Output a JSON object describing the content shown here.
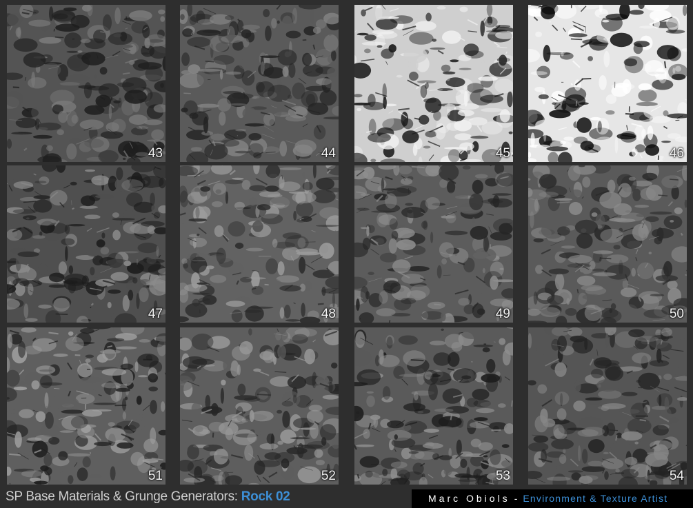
{
  "tiles": [
    {
      "label": "43",
      "tone": "#545454",
      "spot": "#7a7a7a",
      "dark": "#1e1e1e"
    },
    {
      "label": "44",
      "tone": "#5a5a5a",
      "spot": "#858585",
      "dark": "#242424"
    },
    {
      "label": "45",
      "tone": "#cfcfcf",
      "spot": "#f2f2f2",
      "dark": "#1a1a1a"
    },
    {
      "label": "46",
      "tone": "#e6e6e6",
      "spot": "#ffffff",
      "dark": "#0c0c0c"
    },
    {
      "label": "47",
      "tone": "#4f4f4f",
      "spot": "#8a8a8a",
      "dark": "#1c1c1c"
    },
    {
      "label": "48",
      "tone": "#626262",
      "spot": "#9c9c9c",
      "dark": "#2a2a2a"
    },
    {
      "label": "49",
      "tone": "#5c5c5c",
      "spot": "#8e8e8e",
      "dark": "#252525"
    },
    {
      "label": "50",
      "tone": "#5a5a5a",
      "spot": "#8a8a8a",
      "dark": "#2a2a2a"
    },
    {
      "label": "51",
      "tone": "#5f5f5f",
      "spot": "#a0a0a0",
      "dark": "#1e1e1e"
    },
    {
      "label": "52",
      "tone": "#5e5e5e",
      "spot": "#999999",
      "dark": "#262626"
    },
    {
      "label": "53",
      "tone": "#5a5a5a",
      "spot": "#8f8f8f",
      "dark": "#1d1d1d"
    },
    {
      "label": "54",
      "tone": "#555555",
      "spot": "#858585",
      "dark": "#242424"
    }
  ],
  "footer": {
    "title_prefix": "SP Base Materials & Grunge Generators:",
    "title_accent": "Rock 02",
    "author": "Marc Obiols",
    "separator": "-",
    "role": "Environment & Texture Artist"
  },
  "colors": {
    "accent": "#3d8fd6",
    "background": "#2e2e2e"
  }
}
